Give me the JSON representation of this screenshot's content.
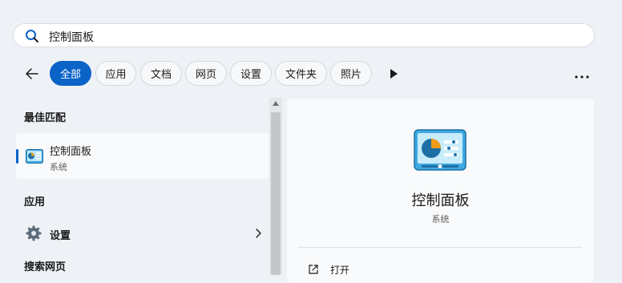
{
  "search": {
    "query": "控制面板"
  },
  "filters": {
    "items": [
      {
        "label": "全部",
        "active": true
      },
      {
        "label": "应用"
      },
      {
        "label": "文档"
      },
      {
        "label": "网页"
      },
      {
        "label": "设置"
      },
      {
        "label": "文件夹"
      },
      {
        "label": "照片"
      }
    ]
  },
  "results": {
    "best_match_heading": "最佳匹配",
    "best_match": {
      "title": "控制面板",
      "subtitle": "系统"
    },
    "apps_heading": "应用",
    "apps": [
      {
        "label": "设置"
      }
    ],
    "web_heading": "搜索网页"
  },
  "preview": {
    "title": "控制面板",
    "subtitle": "系统",
    "actions": [
      {
        "label": "打开"
      }
    ]
  },
  "colors": {
    "accent": "#0a64c8",
    "background": "#eef1f6"
  },
  "icons": [
    "search-icon",
    "back-arrow-icon",
    "play-icon",
    "more-icon",
    "control-panel-icon",
    "gear-icon",
    "chevron-right-icon",
    "open-external-icon"
  ]
}
